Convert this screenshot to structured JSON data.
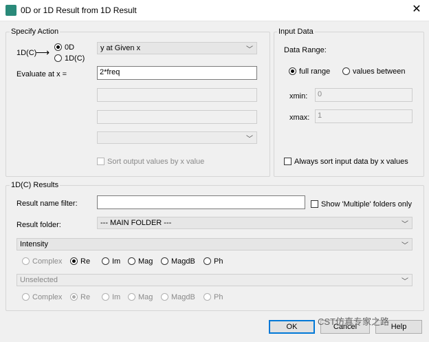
{
  "window": {
    "title": "0D or 1D Result from 1D Result",
    "close": "✕"
  },
  "specify_action": {
    "legend": "Specify Action",
    "source_label": "1D(C)",
    "arrow": "⟶",
    "opt_0d": "0D",
    "opt_1dc": "1D(C)",
    "action_combo": "y at Given x",
    "evaluate_label": "Evaluate at x =",
    "evaluate_value": "2*freq",
    "sort_output": "Sort output values by x value"
  },
  "input_data": {
    "legend": "Input Data",
    "range_label": "Data Range:",
    "full_range": "full range",
    "values_between": "values between",
    "xmin_label": "xmin:",
    "xmin_value": "0",
    "xmax_label": "xmax:",
    "xmax_value": "1",
    "always_sort": "Always sort input data by x values"
  },
  "results": {
    "legend": "1D(C) Results",
    "filter_label": "Result name filter:",
    "filter_value": "",
    "show_multiple": "Show 'Multiple' folders only",
    "folder_label": "Result folder:",
    "folder_value": "--- MAIN FOLDER ---",
    "result_combo": "Intensity",
    "second_combo": "Unselected",
    "complex_opts": [
      "Complex",
      "Re",
      "Im",
      "Mag",
      "MagdB",
      "Ph"
    ]
  },
  "buttons": {
    "ok": "OK",
    "cancel": "Cancel",
    "help": "Help"
  },
  "watermark": "CST仿真专家之路"
}
